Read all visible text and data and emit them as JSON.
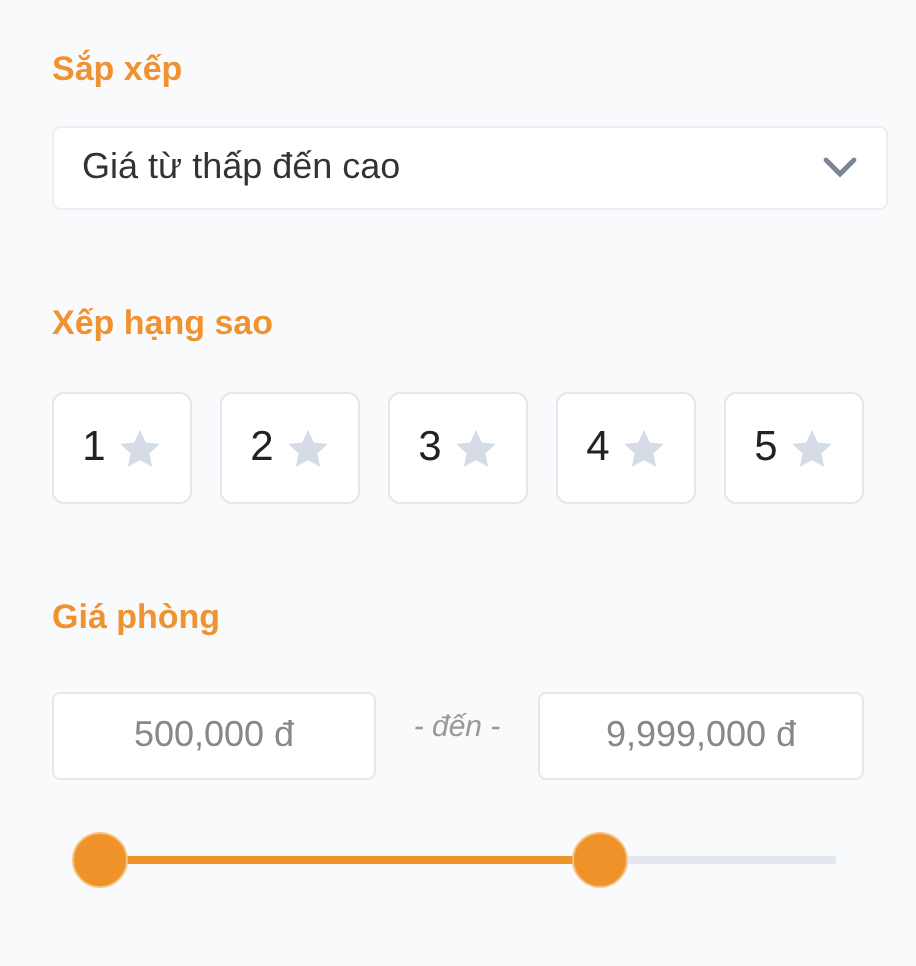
{
  "sort": {
    "title": "Sắp xếp",
    "value": "Giá từ thấp đến cao"
  },
  "rating": {
    "title": "Xếp hạng sao",
    "options": [
      {
        "label": "1",
        "selected": false
      },
      {
        "label": "2",
        "selected": false
      },
      {
        "label": "3",
        "selected": false
      },
      {
        "label": "4",
        "selected": false
      },
      {
        "label": "5",
        "selected": false
      }
    ]
  },
  "price": {
    "title": "Giá phòng",
    "min": "500,000 đ",
    "separator": "- đến -",
    "max": "9,999,000 đ",
    "slider": {
      "thumbs": [
        {
          "level": 0
        },
        {
          "level": 0.68
        }
      ]
    }
  }
}
